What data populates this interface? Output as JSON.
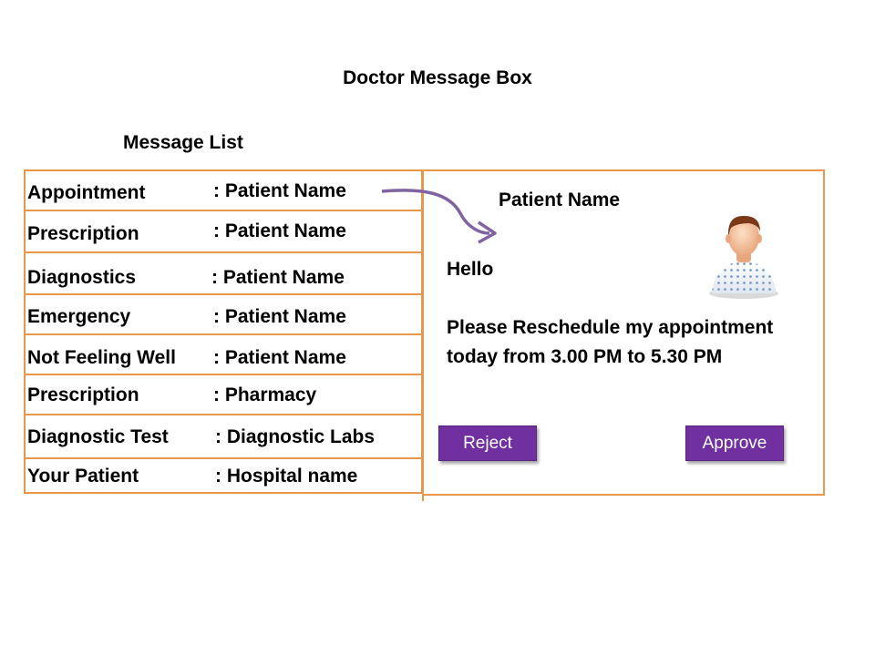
{
  "header": {
    "title": "Doctor Message Box"
  },
  "message_list": {
    "title": "Message List",
    "items": [
      {
        "category": "Appointment",
        "from": ": Patient Name"
      },
      {
        "category": "Prescription",
        "from": ": Patient Name"
      },
      {
        "category": "Diagnostics",
        "from": ": Patient Name"
      },
      {
        "category": "Emergency",
        "from": ": Patient Name"
      },
      {
        "category": "Not Feeling Well",
        "from": ": Patient Name"
      },
      {
        "category": "Prescription",
        "from": ": Pharmacy"
      },
      {
        "category": "Diagnostic Test",
        "from": ": Diagnostic Labs"
      },
      {
        "category": "Your Patient",
        "from": ": Hospital name"
      }
    ]
  },
  "detail": {
    "name": "Patient Name",
    "greeting": "Hello",
    "body": "Please Reschedule my appointment today from 3.00 PM to 5.30 PM",
    "reject_label": "Reject",
    "approve_label": "Approve",
    "avatar_icon": "patient-avatar-icon"
  },
  "colors": {
    "border": "#e8964a",
    "button": "#7030a0",
    "arrow": "#8064a2"
  }
}
